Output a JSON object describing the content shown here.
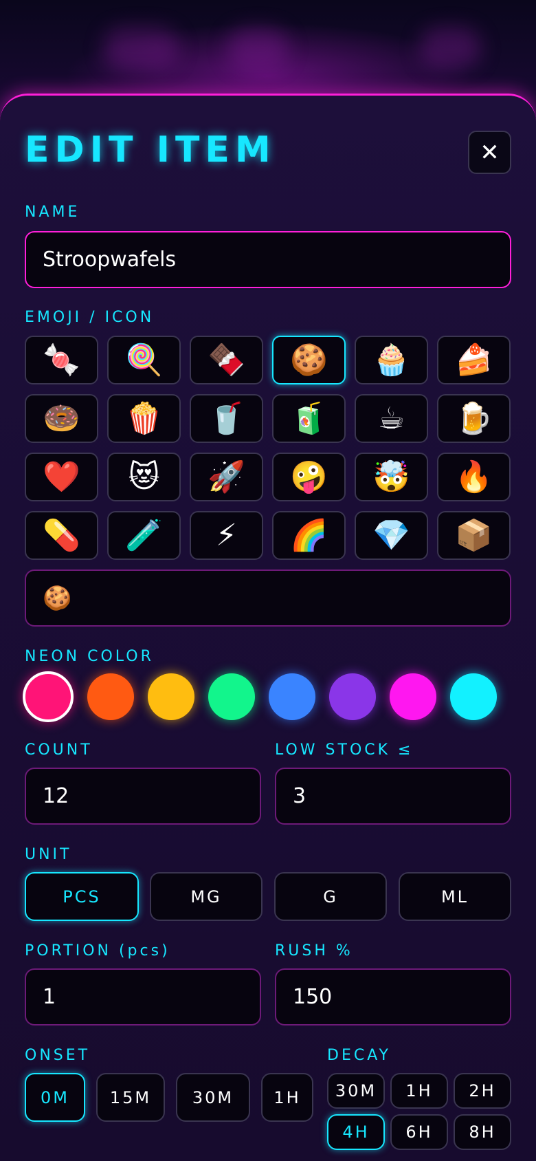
{
  "header": {
    "title": "EDIT ITEM",
    "close_glyph": "✕"
  },
  "name": {
    "label": "NAME",
    "value": "Stroopwafels"
  },
  "emoji": {
    "label": "EMOJI / ICON",
    "items": [
      "🍬",
      "🍭",
      "🍫",
      "🍪",
      "🧁",
      "🍰",
      "🍩",
      "🍿",
      "🥤",
      "🧃",
      "☕",
      "🍺",
      "❤️",
      "😻",
      "🚀",
      "🤪",
      "🤯",
      "🔥",
      "💊",
      "🧪",
      "⚡",
      "🌈",
      "💎",
      "📦"
    ],
    "selected_index": 3,
    "custom_value": "🍪"
  },
  "neon_color": {
    "label": "NEON COLOR",
    "options": [
      "#ff1477",
      "#ff5a12",
      "#ffbd10",
      "#12f58c",
      "#3a84ff",
      "#8a36e8",
      "#ff17f0",
      "#12f1ff"
    ],
    "selected_index": 0
  },
  "count": {
    "label": "COUNT",
    "value": "12"
  },
  "low_stock": {
    "label": "LOW STOCK ≤",
    "value": "3"
  },
  "unit": {
    "label": "UNIT",
    "options": [
      "PCS",
      "MG",
      "G",
      "ML"
    ],
    "selected_index": 0
  },
  "portion": {
    "label": "PORTION (pcs)",
    "value": "1"
  },
  "rush": {
    "label": "RUSH %",
    "value": "150"
  },
  "onset": {
    "label": "ONSET",
    "options": [
      "0M",
      "15M",
      "30M",
      "1H"
    ],
    "selected_index": 0
  },
  "decay": {
    "label": "DECAY",
    "options": [
      "30M",
      "1H",
      "2H",
      "4H",
      "6H",
      "8H"
    ],
    "selected_index": 3
  },
  "colors": {
    "accent_cyan": "#17e7ff",
    "accent_magenta": "#ff1fd9"
  }
}
